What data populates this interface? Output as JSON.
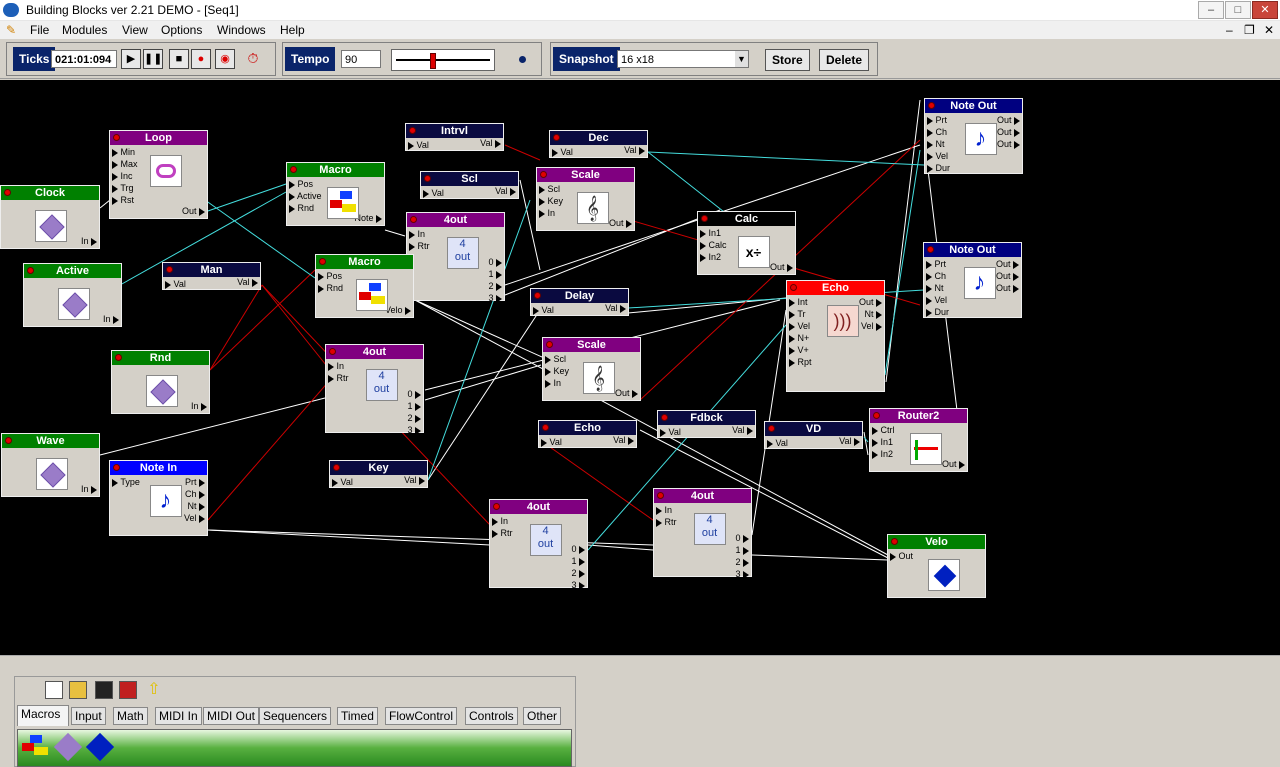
{
  "window": {
    "title": "Building Blocks ver 2.21 DEMO - [Seq1]",
    "controls": [
      "–",
      "□",
      "✕"
    ],
    "child_controls": [
      "–",
      "❐",
      "✕"
    ]
  },
  "menu": [
    "File",
    "Modules",
    "View",
    "Options",
    "Windows",
    "Help"
  ],
  "toolbar": {
    "ticks_label": "Ticks",
    "ticks_value": "021:01:094",
    "transport": [
      "play-icon",
      "pause-icon",
      "stop-icon",
      "record-icon",
      "record-loop-icon",
      "metronome-icon"
    ],
    "tempo_label": "Tempo",
    "tempo_value": "90",
    "snapshot_label": "Snapshot",
    "snapshot_value": "16 x18",
    "store_label": "Store",
    "delete_label": "Delete"
  },
  "modules": [
    {
      "id": "clock",
      "title": "Clock",
      "color": "#008000",
      "in": [],
      "out": [
        "In"
      ],
      "icon": "diamond"
    },
    {
      "id": "loop",
      "title": "Loop",
      "color": "#800080",
      "in": [
        "Min",
        "Max",
        "Inc",
        "Trg",
        "Rst"
      ],
      "out": [
        "Out"
      ],
      "icon": "loop"
    },
    {
      "id": "macro1",
      "title": "Macro",
      "color": "#008000",
      "in": [
        "Pos",
        "Active",
        "Rnd"
      ],
      "out": [
        "Note"
      ],
      "icon": "blocks"
    },
    {
      "id": "intrvl",
      "title": "Intrvl",
      "color": "#0a0a40",
      "in": [
        "Val"
      ],
      "out": [
        "Val"
      ],
      "icon": ""
    },
    {
      "id": "dec",
      "title": "Dec",
      "color": "#0a0a40",
      "in": [
        "Val"
      ],
      "out": [
        "Val"
      ],
      "icon": ""
    },
    {
      "id": "noteout1",
      "title": "Note Out",
      "color": "#000080",
      "in": [
        "Prt",
        "Ch",
        "Nt",
        "Vel",
        "Dur"
      ],
      "out": [
        "Out",
        "Out",
        "Out"
      ],
      "icon": "note"
    },
    {
      "id": "scl",
      "title": "Scl",
      "color": "#0a0a40",
      "in": [
        "Val"
      ],
      "out": [
        "Val"
      ],
      "icon": ""
    },
    {
      "id": "scale1",
      "title": "Scale",
      "color": "#800080",
      "in": [
        "Scl",
        "Key",
        "In"
      ],
      "out": [
        "Out"
      ],
      "icon": "clef"
    },
    {
      "id": "active",
      "title": "Active",
      "color": "#008000",
      "in": [],
      "out": [
        "In"
      ],
      "icon": "diamond"
    },
    {
      "id": "man",
      "title": "Man",
      "color": "#0a0a40",
      "in": [
        "Val"
      ],
      "out": [
        "Val"
      ],
      "icon": ""
    },
    {
      "id": "4out1",
      "title": "4out",
      "color": "#800080",
      "in": [
        "In",
        "Rtr"
      ],
      "out": [
        "0",
        "1",
        "2",
        "3"
      ],
      "icon": "4out"
    },
    {
      "id": "calc",
      "title": "Calc",
      "color": "#000000",
      "in": [
        "In1",
        "Calc",
        "In2"
      ],
      "out": [
        "Out"
      ],
      "icon": "calc"
    },
    {
      "id": "noteout2",
      "title": "Note Out",
      "color": "#000080",
      "in": [
        "Prt",
        "Ch",
        "Nt",
        "Vel",
        "Dur"
      ],
      "out": [
        "Out",
        "Out",
        "Out"
      ],
      "icon": "note"
    },
    {
      "id": "macro2",
      "title": "Macro",
      "color": "#008000",
      "in": [
        "Pos",
        "Rnd"
      ],
      "out": [
        "Velo"
      ],
      "icon": "blocks"
    },
    {
      "id": "delay",
      "title": "Delay",
      "color": "#0a0a40",
      "in": [
        "Val"
      ],
      "out": [
        "Val"
      ],
      "icon": ""
    },
    {
      "id": "echo1",
      "title": "Echo",
      "color": "#ff0000",
      "in": [
        "Int",
        "Tr",
        "Vel",
        "N+",
        "V+",
        "Rpt"
      ],
      "out": [
        "Out",
        "Nt",
        "Vel"
      ],
      "icon": "echo"
    },
    {
      "id": "rnd",
      "title": "Rnd",
      "color": "#008000",
      "in": [],
      "out": [
        "In"
      ],
      "icon": "diamond"
    },
    {
      "id": "4out2",
      "title": "4out",
      "color": "#800080",
      "in": [
        "In",
        "Rtr"
      ],
      "out": [
        "0",
        "1",
        "2",
        "3"
      ],
      "icon": "4out"
    },
    {
      "id": "scale2",
      "title": "Scale",
      "color": "#800080",
      "in": [
        "Scl",
        "Key",
        "In"
      ],
      "out": [
        "Out"
      ],
      "icon": "clef"
    },
    {
      "id": "fdbck",
      "title": "Fdbck",
      "color": "#0a0a40",
      "in": [
        "Val"
      ],
      "out": [
        "Val"
      ],
      "icon": ""
    },
    {
      "id": "echo2",
      "title": "Echo",
      "color": "#0a0a40",
      "in": [
        "Val"
      ],
      "out": [
        "Val"
      ],
      "icon": ""
    },
    {
      "id": "vd",
      "title": "VD",
      "color": "#0a0a40",
      "in": [
        "Val"
      ],
      "out": [
        "Val"
      ],
      "icon": ""
    },
    {
      "id": "router2",
      "title": "Router2",
      "color": "#800080",
      "in": [
        "Ctrl",
        "In1",
        "In2"
      ],
      "out": [
        "Out"
      ],
      "icon": "router"
    },
    {
      "id": "wave",
      "title": "Wave",
      "color": "#008000",
      "in": [],
      "out": [
        "In"
      ],
      "icon": "diamond"
    },
    {
      "id": "notein",
      "title": "Note In",
      "color": "#0000ff",
      "in": [
        "Type"
      ],
      "out": [
        "Prt",
        "Ch",
        "Nt",
        "Vel"
      ],
      "icon": "note"
    },
    {
      "id": "key",
      "title": "Key",
      "color": "#0a0a40",
      "in": [
        "Val"
      ],
      "out": [
        "Val"
      ],
      "icon": ""
    },
    {
      "id": "4out3",
      "title": "4out",
      "color": "#800080",
      "in": [
        "In",
        "Rtr"
      ],
      "out": [
        "0",
        "1",
        "2",
        "3"
      ],
      "icon": "4out"
    },
    {
      "id": "4out4",
      "title": "4out",
      "color": "#800080",
      "in": [
        "In",
        "Rtr"
      ],
      "out": [
        "0",
        "1",
        "2",
        "3"
      ],
      "icon": "4out"
    },
    {
      "id": "velo",
      "title": "Velo",
      "color": "#008000",
      "in": [
        "Out"
      ],
      "out": [],
      "icon": "bluediamond"
    }
  ],
  "wire_colors": {
    "white": "#ffffff",
    "red": "#cc0000",
    "cyan": "#44dddd"
  },
  "palette": {
    "toolbar_icons": [
      "new-icon",
      "open-icon",
      "save-icon",
      "save-as-icon",
      "up-icon"
    ],
    "tabs": [
      "Macros",
      "Input",
      "Math",
      "MIDI In",
      "MIDI Out",
      "Sequencers",
      "Timed",
      "FlowControl",
      "Controls",
      "Other"
    ],
    "active_tab": "Macros",
    "items": [
      "blocks-icon",
      "diamond-icon",
      "blue-diamond-icon"
    ]
  }
}
